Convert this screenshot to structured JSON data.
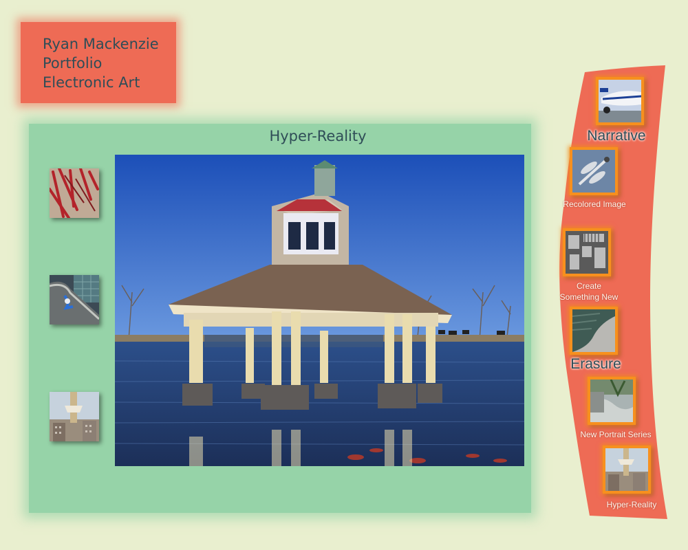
{
  "header": {
    "lines": [
      "Ryan Mackenzie",
      "Portfolio",
      "Electronic Art"
    ]
  },
  "main": {
    "title": "Hyper-Reality",
    "hero_image": "gazebo-on-lake-photo",
    "side_thumbnails": [
      "branches-thumbnail",
      "building-ledge-thumbnail",
      "tower-thumbnail"
    ]
  },
  "nav": {
    "items": [
      {
        "label": "Narrative",
        "style": "big",
        "thumb": "airplane-thumbnail"
      },
      {
        "label": "Recolored Image",
        "style": "small",
        "thumb": "dragonfly-thumbnail"
      },
      {
        "label": "Create Something New",
        "line1": "Create",
        "line2": "Something New",
        "style": "small",
        "thumb": "machinery-thumbnail"
      },
      {
        "label": "Erasure",
        "style": "big",
        "thumb": "erasure-thumbnail"
      },
      {
        "label": "New Portrait Series",
        "style": "small",
        "thumb": "portrait-thumbnail"
      },
      {
        "label": "Hyper-Reality",
        "style": "small",
        "thumb": "hyper-reality-thumbnail"
      }
    ]
  },
  "colors": {
    "background": "#e9efcf",
    "title_box": "#ee6b55",
    "main_panel": "#96d3a8",
    "nav_band": "#ee6b55",
    "thumb_border": "#f7901e",
    "text": "#2f4d57"
  }
}
